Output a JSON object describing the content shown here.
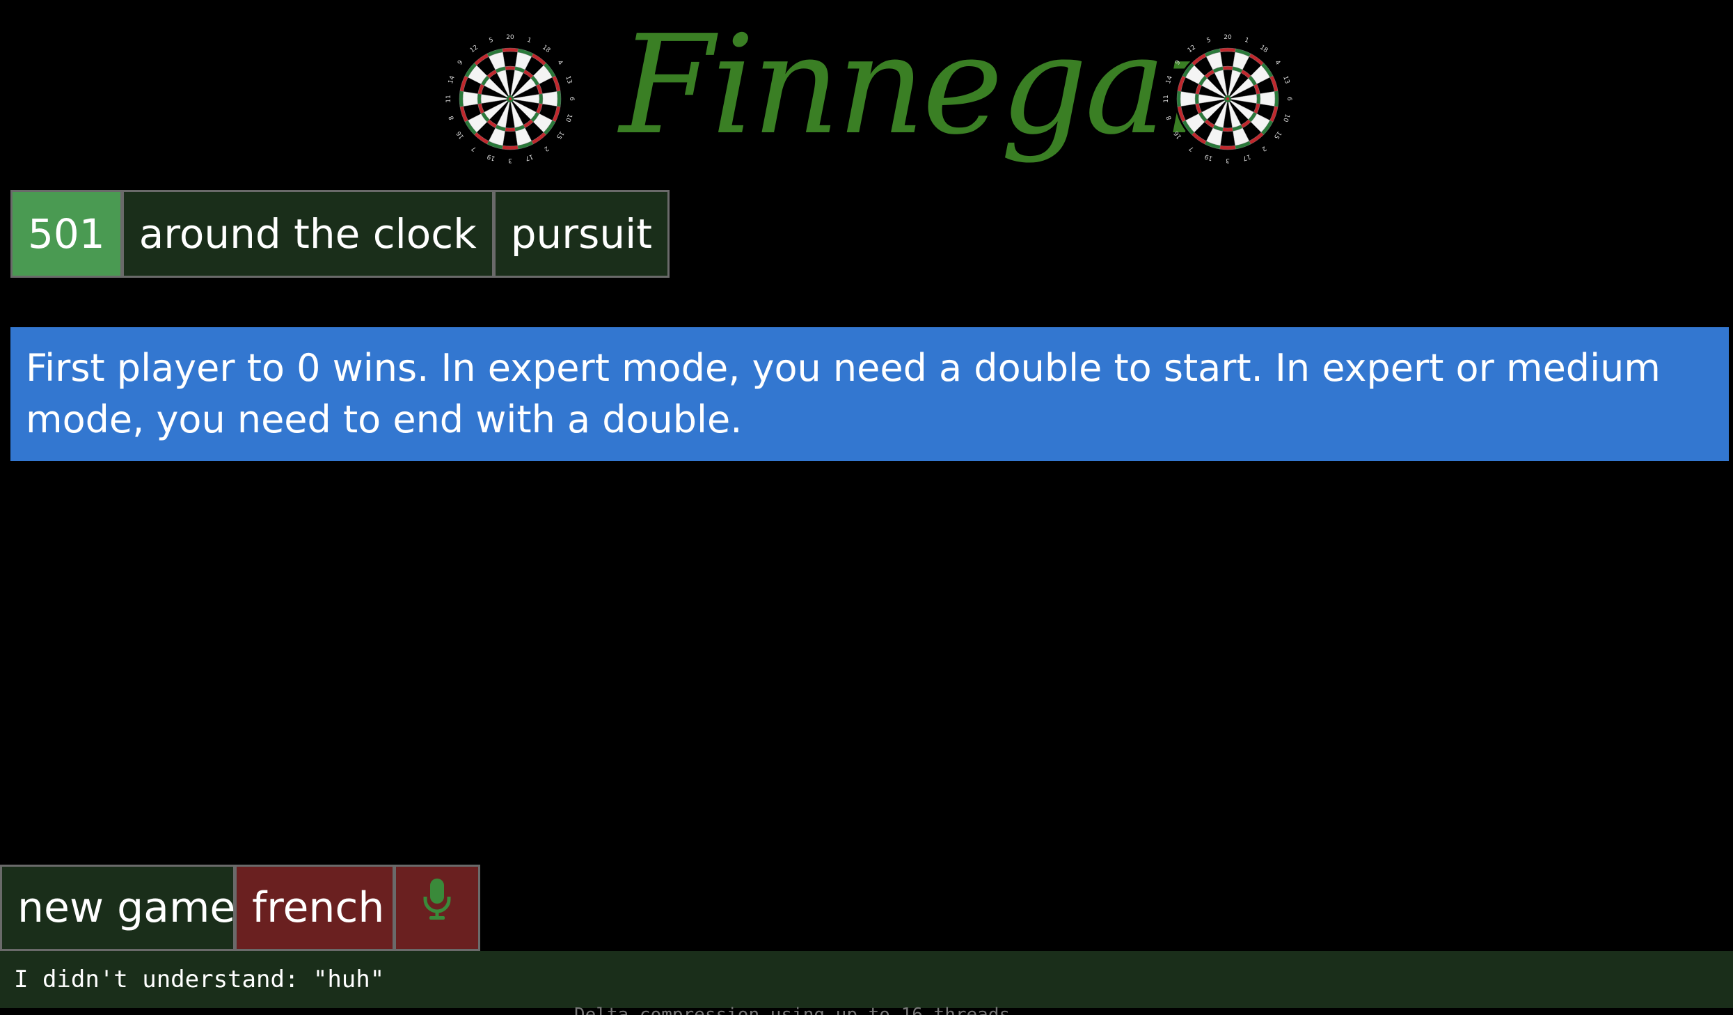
{
  "header": {
    "title": "Finnegan",
    "title_color": "#3a7f24",
    "dartboard_numbers": [
      "20",
      "1",
      "18",
      "4",
      "13",
      "6",
      "10",
      "15",
      "2",
      "17",
      "3",
      "19",
      "7",
      "16",
      "8",
      "11",
      "14",
      "9",
      "12",
      "5"
    ]
  },
  "tabs": [
    {
      "label": "501",
      "active": true
    },
    {
      "label": "around the clock",
      "active": false
    },
    {
      "label": "pursuit",
      "active": false
    }
  ],
  "description": "First player to 0 wins. In expert mode, you need a double to start. In expert or medium mode, you need to end with a double.",
  "bottom_bar": {
    "new_game_label": "new game",
    "language_label": "french",
    "mic_icon": "microphone-icon"
  },
  "status_message": "I didn't understand: \"huh\"",
  "terminal_peek": "Delta compression using up to 16 threads",
  "colors": {
    "active_tab": "#4a9a52",
    "inactive_tab": "#1a2e1a",
    "description_bg": "#3377d0",
    "language_button": "#6a2020",
    "mic_icon": "#3a8a3a"
  }
}
